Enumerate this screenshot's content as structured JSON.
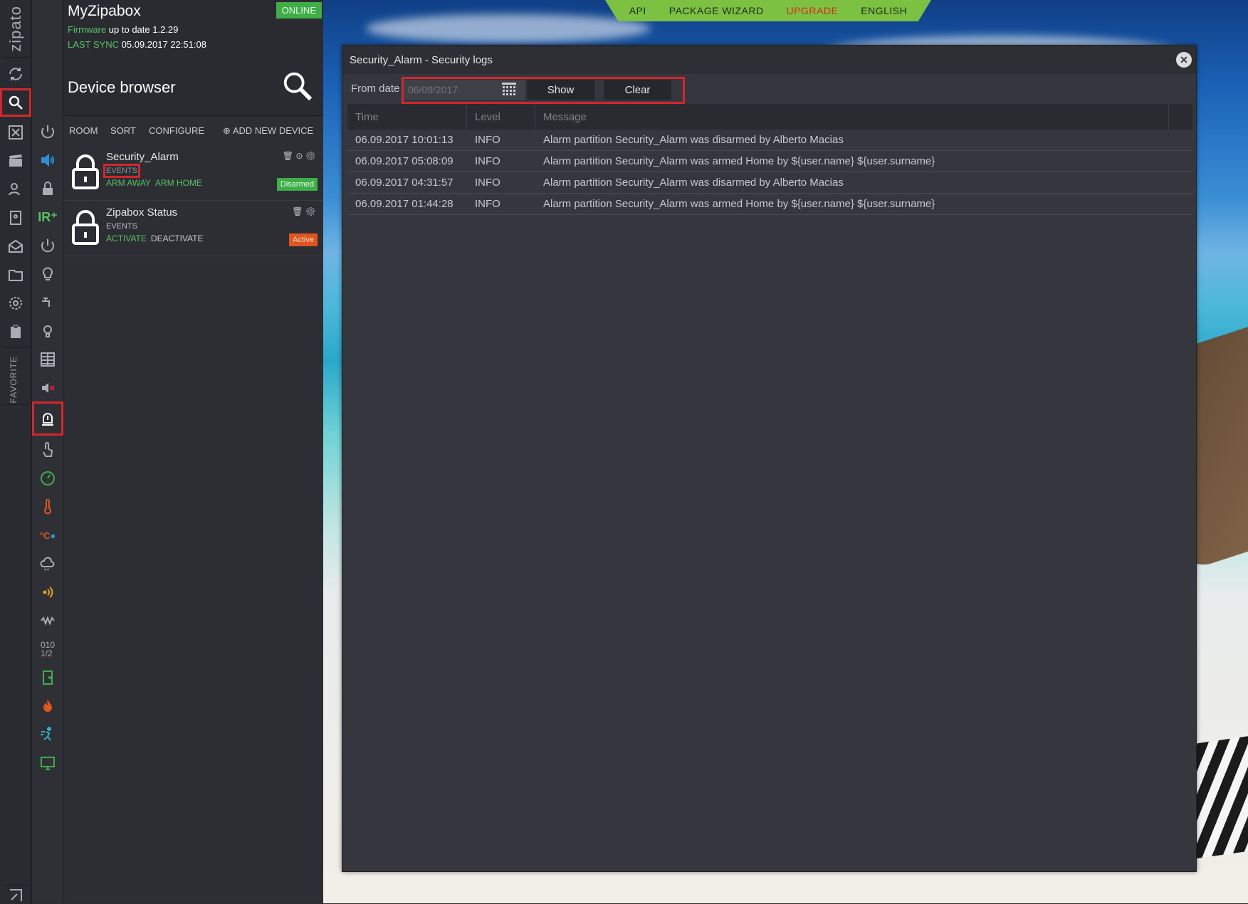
{
  "app": {
    "name": "MyZipabox",
    "status": "ONLINE",
    "firmware_label": "Firmware",
    "firmware_text": "up to date 1.2.29",
    "sync_label": "LAST SYNC",
    "sync_value": "05.09.2017 22:51:08",
    "logo": "zipato",
    "favorite_label": "FAVORITE"
  },
  "browser": {
    "title": "Device browser",
    "toolbar": {
      "room": "ROOM",
      "sort": "SORT",
      "configure": "CONFIGURE",
      "add": "ADD NEW DEVICE"
    }
  },
  "devices": [
    {
      "name": "Security_Alarm",
      "sub": "EVENTS",
      "actions": [
        "ARM AWAY",
        "ARM HOME"
      ],
      "state": "Disarmed",
      "state_color": "#3fae49"
    },
    {
      "name": "Zipabox Status",
      "sub": "EVENTS",
      "actions": [
        "ACTIVATE",
        "DEACTIVATE"
      ],
      "state": "Active",
      "state_color": "#e0561e"
    }
  ],
  "topnav": [
    "API",
    "PACKAGE WIZARD",
    "UPGRADE",
    "ENGLISH"
  ],
  "dialog": {
    "title": "Security_Alarm - Security logs",
    "from_label": "From date",
    "date_placeholder": "06/09/2017",
    "show_label": "Show",
    "clear_label": "Clear",
    "columns": [
      "Time",
      "Level",
      "Message"
    ],
    "rows": [
      [
        "06.09.2017 10:01:13",
        "INFO",
        "Alarm partition Security_Alarm was disarmed by Alberto Macias"
      ],
      [
        "06.09.2017 05:08:09",
        "INFO",
        "Alarm partition Security_Alarm was armed Home by ${user.name} ${user.surname}"
      ],
      [
        "06.09.2017 04:31:57",
        "INFO",
        "Alarm partition Security_Alarm was disarmed by Alberto Macias"
      ],
      [
        "06.09.2017 01:44:28",
        "INFO",
        "Alarm partition Security_Alarm was armed Home by ${user.name} ${user.surname}"
      ]
    ]
  },
  "rail1_icons": [
    "refresh-icon",
    "search-icon",
    "scenes-icon",
    "clapper-icon",
    "users-icon",
    "contacts-icon",
    "mail-icon",
    "folder-icon",
    "settings-icon",
    "clipboard-icon"
  ],
  "rail2_icons": [
    "power-icon",
    "speaker-icon",
    "lock-icon",
    "ir-icon",
    "power-icon",
    "bulb-icon",
    "faucet-icon",
    "bulb-icon",
    "shutter-icon",
    "mute-icon",
    "alarm-icon",
    "touch-icon",
    "meter-icon",
    "thermometer-icon",
    "temp-humidity-icon",
    "weather-icon",
    "signal-icon",
    "vibration-icon",
    "binary-icon",
    "door-icon",
    "fire-icon",
    "motion-icon",
    "http-icon"
  ]
}
